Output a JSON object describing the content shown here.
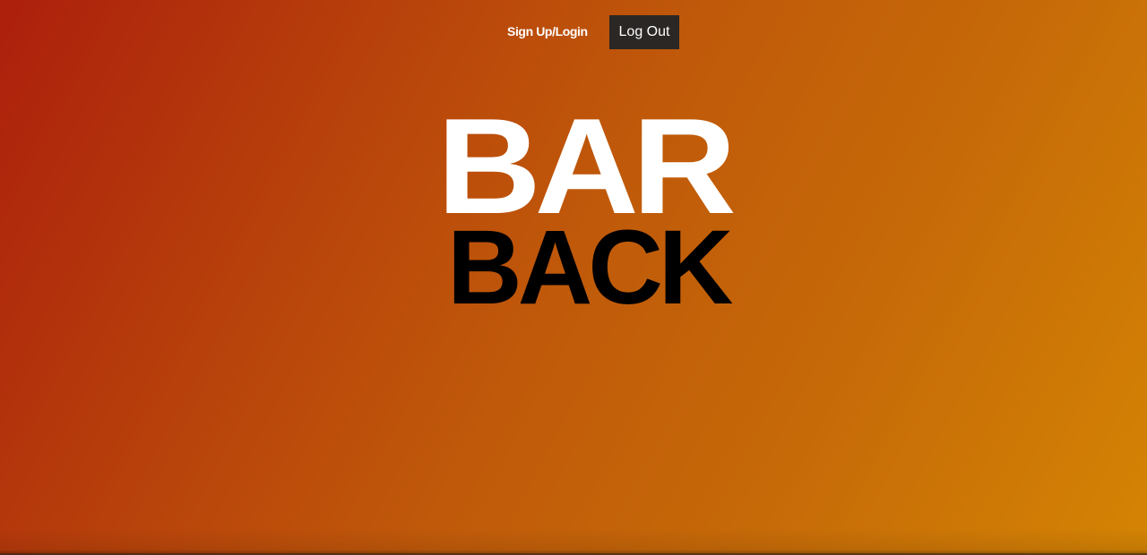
{
  "nav": {
    "signup_login_label": "Sign Up/Login",
    "logout_label": "Log Out"
  },
  "logo": {
    "line1": "BAR",
    "line2": "BACK"
  },
  "colors": {
    "gradient_start": "#ac1f0c",
    "gradient_end": "#d48404",
    "logout_button_bg": "#2a2725",
    "logo_line1": "#ffffff",
    "logo_line2": "#000000"
  }
}
